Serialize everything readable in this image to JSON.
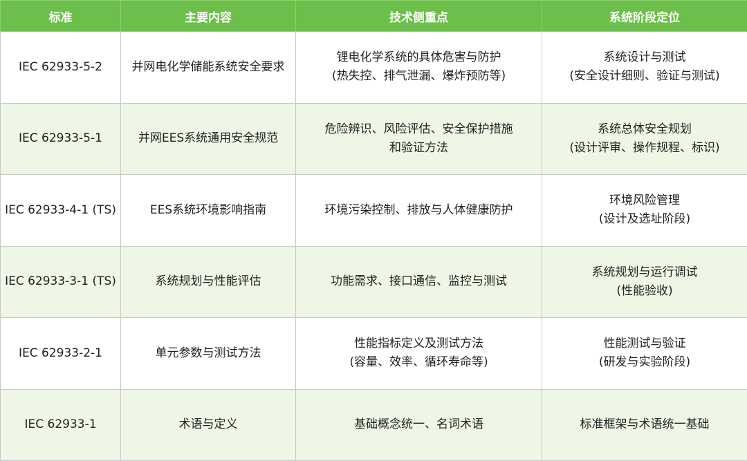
{
  "table": {
    "headers": [
      "标准",
      "主要内容",
      "技术侧重点",
      "系统阶段定位"
    ],
    "rows": [
      {
        "standard": "IEC 62933-5-2",
        "content": "并网电化学储能系统安全要求",
        "focus": [
          "锂电化学系统的具体危害与防护",
          "(热失控、排气泄漏、爆炸预防等)"
        ],
        "stage": [
          "系统设计与测试",
          "(安全设计细则、验证与测试)"
        ]
      },
      {
        "standard": "IEC 62933-5-1",
        "content": "并网EES系统通用安全规范",
        "focus": [
          "危险辨识、风险评估、安全保护措施",
          "和验证方法"
        ],
        "stage": [
          "系统总体安全规划",
          "(设计评审、操作规程、标识)"
        ]
      },
      {
        "standard": "IEC 62933-4-1 (TS)",
        "content": "EES系统环境影响指南",
        "focus": [
          "环境污染控制、排放与人体健康防护",
          ""
        ],
        "stage": [
          "环境风险管理",
          "(设计及选址阶段)"
        ]
      },
      {
        "standard": "IEC 62933-3-1 (TS)",
        "content": "系统规划与性能评估",
        "focus": [
          "功能需求、接口通信、监控与测试",
          ""
        ],
        "stage": [
          "系统规划与运行调试",
          "(性能验收)"
        ]
      },
      {
        "standard": "IEC 62933-2-1",
        "content": "单元参数与测试方法",
        "focus": [
          "性能指标定义及测试方法",
          "(容量、效率、循环寿命等)"
        ],
        "stage": [
          "性能测试与验证",
          "(研发与实验阶段)"
        ]
      },
      {
        "standard": "IEC 62933-1",
        "content": "术语与定义",
        "focus": [
          "基础概念统一、名词术语",
          ""
        ],
        "stage": [
          "标准框架与术语统一基础",
          ""
        ]
      }
    ]
  }
}
